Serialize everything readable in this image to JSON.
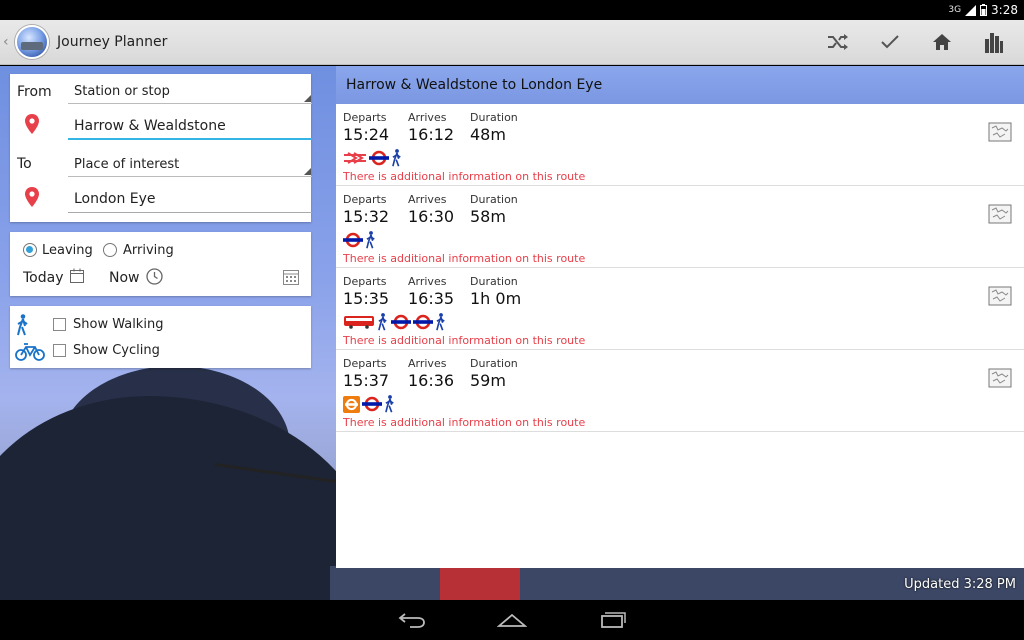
{
  "status": {
    "network": "3G",
    "time": "3:28"
  },
  "app": {
    "title": "Journey Planner"
  },
  "actions": [
    "shuffle-icon",
    "check-icon",
    "home-icon",
    "city-icon"
  ],
  "route": {
    "from_label": "From",
    "from_type": "Station or stop",
    "from_value": "Harrow & Wealdstone",
    "to_label": "To",
    "to_type": "Place of interest",
    "to_value": "London Eye"
  },
  "time": {
    "leaving": "Leaving",
    "arriving": "Arriving",
    "selected": "leaving",
    "date": "Today",
    "time": "Now"
  },
  "options": {
    "walking": "Show Walking",
    "cycling": "Show Cycling"
  },
  "results": {
    "header": "Harrow & Wealdstone to London Eye",
    "col_departs": "Departs",
    "col_arrives": "Arrives",
    "col_duration": "Duration",
    "info_text": "There is additional information on this route",
    "journeys": [
      {
        "departs": "15:24",
        "arrives": "16:12",
        "duration": "48m",
        "modes": [
          "rail",
          "tube",
          "walk"
        ]
      },
      {
        "departs": "15:32",
        "arrives": "16:30",
        "duration": "58m",
        "modes": [
          "tube",
          "walk"
        ]
      },
      {
        "departs": "15:35",
        "arrives": "16:35",
        "duration": "1h 0m",
        "modes": [
          "bus",
          "walk",
          "tube",
          "tube",
          "walk"
        ]
      },
      {
        "departs": "15:37",
        "arrives": "16:36",
        "duration": "59m",
        "modes": [
          "overground",
          "tube",
          "walk"
        ]
      }
    ]
  },
  "updated": "Updated 3:28 PM",
  "colors": {
    "accent": "#33b5e5",
    "pin": "#e8404a",
    "tube": "#dc241f",
    "tube_bar": "#0019a8",
    "info": "#e8404a"
  }
}
